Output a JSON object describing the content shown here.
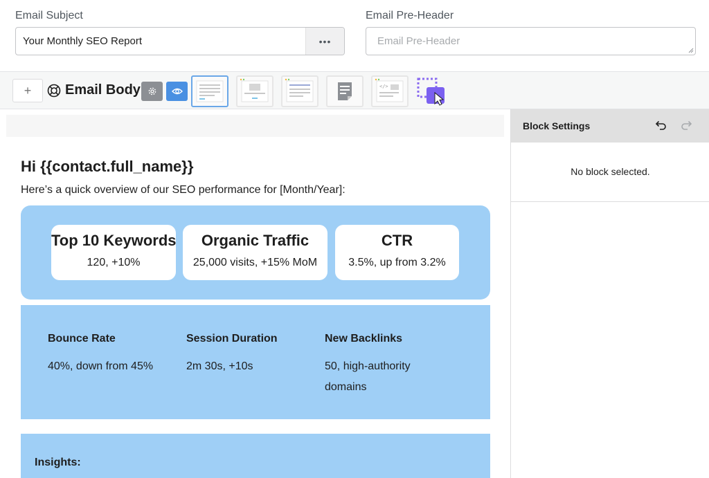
{
  "fields": {
    "subject_label": "Email Subject",
    "subject_value": "Your Monthly SEO Report",
    "subject_more": "•••",
    "preheader_label": "Email Pre-Header",
    "preheader_placeholder": "Email Pre-Header"
  },
  "toolbar": {
    "add_label": "+",
    "title": "Email Body",
    "buttons": [
      {
        "name": "settings",
        "icon": "gear-icon",
        "color": "#8c8f94"
      },
      {
        "name": "preview",
        "icon": "eye-icon",
        "color": "#4a90e2"
      }
    ],
    "templates": [
      {
        "icon": "template-text-icon",
        "selected": true
      },
      {
        "icon": "template-image-icon",
        "selected": false
      },
      {
        "icon": "template-list-icon",
        "selected": false
      },
      {
        "icon": "template-note-icon",
        "selected": false
      },
      {
        "icon": "template-code-icon",
        "selected": false
      }
    ]
  },
  "email": {
    "greeting": "Hi {{contact.full_name}}",
    "intro": "Here’s a quick overview of our SEO performance for [Month/Year]:",
    "cards": [
      {
        "title": "Top 10 Keywords",
        "value": "120, +10%"
      },
      {
        "title": "Organic Traffic",
        "value": "25,000 visits, +15% MoM"
      },
      {
        "title": "CTR",
        "value": "3.5%, up from 3.2%"
      }
    ],
    "stats": [
      {
        "title": "Bounce Rate",
        "value": "40%, down from 45%"
      },
      {
        "title": "Session Duration",
        "value": "2m 30s, +10s"
      },
      {
        "title": "New Backlinks",
        "value": "50, high-authority domains"
      }
    ],
    "insights_title": "Insights:",
    "panel_color": "#9fcff6"
  },
  "sidebar": {
    "title": "Block Settings",
    "empty_message": "No block selected.",
    "undo_icon": "undo-icon",
    "redo_icon": "redo-icon"
  }
}
